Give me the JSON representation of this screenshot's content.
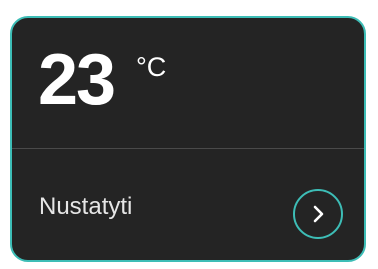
{
  "widget": {
    "temperature": "23",
    "unit": "°C",
    "action_label": "Nustatyti"
  },
  "icons": {
    "go": "chevron-right-icon"
  },
  "colors": {
    "accent": "#3dbdb6",
    "card_background": "#242424",
    "text": "#ffffff"
  }
}
